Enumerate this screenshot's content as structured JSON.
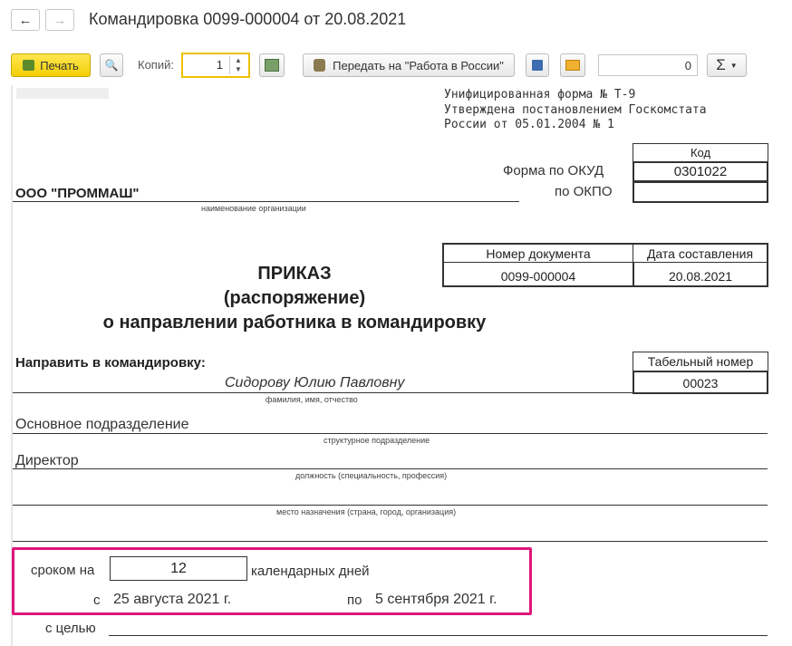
{
  "window": {
    "title": "Командировка 0099-000004 от 20.08.2021"
  },
  "toolbar": {
    "print_label": "Печать",
    "copies_label": "Копий:",
    "copies_value": "1",
    "send_label": "Передать на \"Работа в России\"",
    "sum_value": "0",
    "sum_symbol": "Σ"
  },
  "doc": {
    "form_lines": [
      "Унифицированная форма № Т-9",
      "Утверждена постановлением Госкомстата",
      "России от 05.01.2004 № 1"
    ],
    "code_header": "Код",
    "okud_label": "Форма по ОКУД",
    "okud_value": "0301022",
    "okpo_label": "по ОКПО",
    "okpo_value": "",
    "org_name": "ООО \"ПРОММАШ\"",
    "org_caption": "наименование организации",
    "docnum_header": "Номер документа",
    "docdate_header": "Дата составления",
    "docnum_value": "0099-000004",
    "docdate_value": "20.08.2021",
    "title_1": "ПРИКАЗ",
    "title_2": "(распоряжение)",
    "title_3": "о направлении работника в командировку",
    "send_label": "Направить в командировку:",
    "tab_header": "Табельный номер",
    "tab_value": "00023",
    "employee_name": "Сидорову Юлию Павловну",
    "employee_caption": "фамилия, имя, отчество",
    "department": "Основное подразделение",
    "department_caption": "структурное подразделение",
    "position": "Директор",
    "position_caption": "должность (специальность, профессия)",
    "destination": "",
    "destination_caption": "место назначения (страна, город, организация)",
    "term_label": "сроком на",
    "term_value": "12",
    "term_unit": "календарных дней",
    "from_label": "с",
    "from_date": "25 августа 2021 г.",
    "to_label": "по",
    "to_date": "5 сентября 2021 г.",
    "purpose_label": "с целью",
    "purpose_value": ""
  },
  "colors": {
    "highlight": "#e0157d",
    "print_button": "#f3cf06",
    "copies_border": "#f0c000"
  },
  "icons": [
    "back-arrow-icon",
    "forward-arrow-icon",
    "print-icon",
    "preview-icon",
    "edit-icon",
    "coat-of-arms-icon",
    "save-icon",
    "mail-icon",
    "sum-icon",
    "chevron-down-icon"
  ]
}
